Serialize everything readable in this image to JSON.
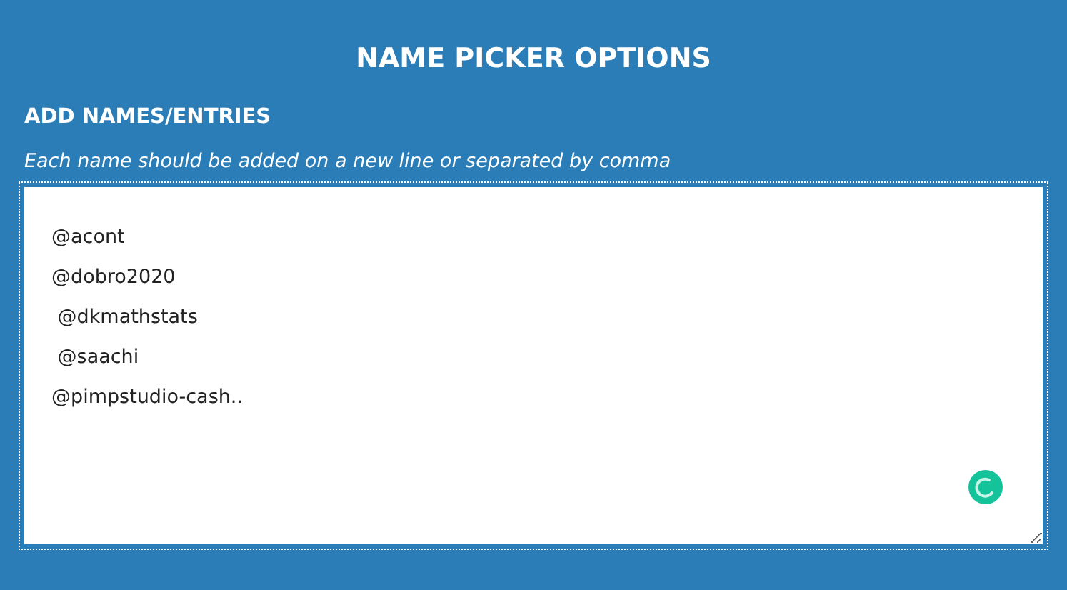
{
  "title": "NAME PICKER OPTIONS",
  "section": {
    "heading": "ADD NAMES/ENTRIES",
    "hint": "Each name should be added on a new line or separated by comma"
  },
  "entries": [
    "@acont",
    "@dobro2020",
    " @dkmathstats",
    " @saachi",
    "@pimpstudio-cash.."
  ]
}
